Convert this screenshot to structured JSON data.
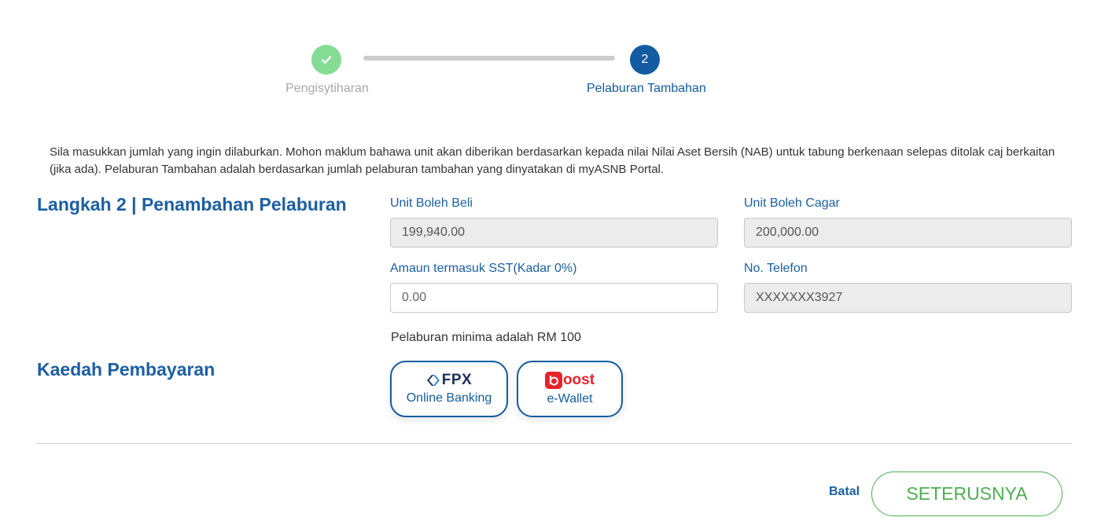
{
  "stepper": {
    "steps": [
      {
        "label": "Pengisytiharan",
        "state": "completed",
        "color": "#86dc95"
      },
      {
        "number": "2",
        "label": "Pelaburan Tambahan",
        "state": "active",
        "color": "#135ca3"
      }
    ]
  },
  "intro": {
    "text": "Sila masukkan jumlah yang ingin dilaburkan. Mohon maklum bahawa unit akan diberikan berdasarkan kepada nilai Nilai Aset Bersih (NAB) untuk tabung berkenaan selepas ditolak caj berkaitan (jika ada). Pelaburan Tambahan adalah berdasarkan jumlah pelaburan tambahan yang dinyatakan di myASNB Portal."
  },
  "investment": {
    "title": "Langkah 2 | Penambahan Pelaburan",
    "unit_boleh_beli": {
      "label": "Unit Boleh Beli",
      "value": "199,940.00"
    },
    "unit_boleh_cagar": {
      "label": "Unit Boleh Cagar",
      "value": "200,000.00"
    },
    "amount": {
      "label": "Amaun termasuk SST(Kadar 0%)",
      "placeholder": "0.00"
    },
    "phone": {
      "label": "No. Telefon",
      "value": "XXXXXXX3927"
    },
    "min_note": "Pelaburan minima adalah RM 100"
  },
  "payment": {
    "title": "Kaedah Pembayaran",
    "methods": [
      {
        "logo_text": "FPX",
        "label": "Online Banking",
        "icon": "fpx-logo-icon"
      },
      {
        "logo_text": "oost",
        "label": "e-Wallet",
        "icon": "boost-logo-icon"
      }
    ]
  },
  "actions": {
    "cancel_label": "Batal",
    "next_label": "SETERUSNYA"
  },
  "colors": {
    "primary": "#135ca3",
    "heading": "#1b5fa3",
    "success": "#4caf50",
    "completed_step": "#86dc95",
    "boost_red": "#e8232a"
  }
}
